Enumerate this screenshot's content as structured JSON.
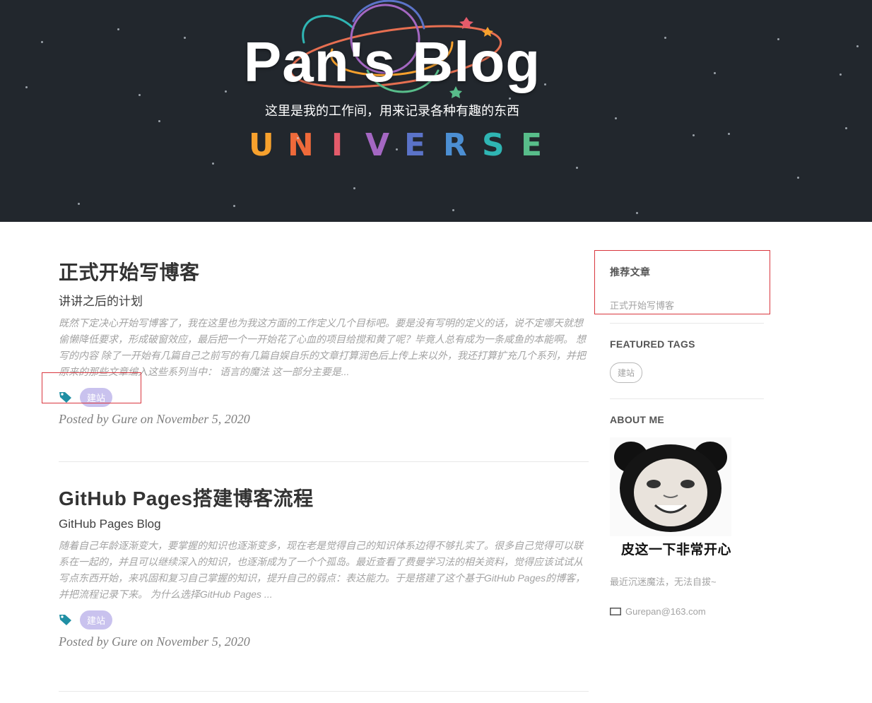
{
  "header": {
    "title": "Pan's Blog",
    "subtitle": "这里是我的工作间，用来记录各种有趣的东西",
    "universe_letters": [
      {
        "ch": "U",
        "color": "#f7a12d"
      },
      {
        "ch": "N",
        "color": "#ef6a3a"
      },
      {
        "ch": "I",
        "color": "#e45b6b"
      },
      {
        "ch": "V",
        "color": "#a467c2"
      },
      {
        "ch": "E",
        "color": "#5b73c8"
      },
      {
        "ch": "R",
        "color": "#4c8fd3"
      },
      {
        "ch": "S",
        "color": "#2fb5b3"
      },
      {
        "ch": "E",
        "color": "#58bd8a"
      }
    ]
  },
  "posts": [
    {
      "title": "正式开始写博客",
      "subtitle": "讲讲之后的计划",
      "excerpt": "既然下定决心开始写博客了，我在这里也为我这方面的工作定义几个目标吧。要是没有写明的定义的话，说不定哪天就想偷懒降低要求，形成破窗效应，最后把一个一开始花了心血的项目给搅和黄了呢？毕竟人总有成为一条咸鱼的本能啊。 想写的内容 除了一开始有几篇自己之前写的有几篇自娱自乐的文章打算润色后上传上来以外，我还打算扩充几个系列，并把原来的那些文章编入这些系列当中： 语言的魔法 这一部分主要是...",
      "tag": "建站",
      "meta": "Posted by Gure on November 5, 2020"
    },
    {
      "title": "GitHub Pages搭建博客流程",
      "subtitle": "GitHub Pages Blog",
      "excerpt": "随着自己年龄逐渐变大，要掌握的知识也逐渐变多，现在老是觉得自己的知识体系边得不够扎实了。很多自己觉得可以联系在一起的，并且可以继续深入的知识，也逐渐成为了一个个孤岛。最近查看了费曼学习法的相关资料，觉得应该试试从写点东西开始，来巩固和复习自己掌握的知识，提升自己的弱点：表达能力。于是搭建了这个基于GitHub Pages的博客，并把流程记录下来。 为什么选择GitHub Pages ...",
      "tag": "建站",
      "meta": "Posted by Gure on November 5, 2020"
    }
  ],
  "sidebar": {
    "recommended": {
      "heading": "推荐文章",
      "items": [
        "正式开始写博客"
      ]
    },
    "featured_tags": {
      "heading": "FEATURED TAGS",
      "tags": [
        "建站"
      ]
    },
    "about": {
      "heading": "ABOUT ME",
      "meme_caption": "皮这一下非常开心",
      "bio": "最近沉迷魔法，无法自拔~",
      "email": "Gurepan@163.com"
    }
  },
  "colors": {
    "hero_bg": "#22272d",
    "tag_pill": "#c9c2ee",
    "tag_icon": "#1f8fa4",
    "annotation": "#d9363e"
  }
}
